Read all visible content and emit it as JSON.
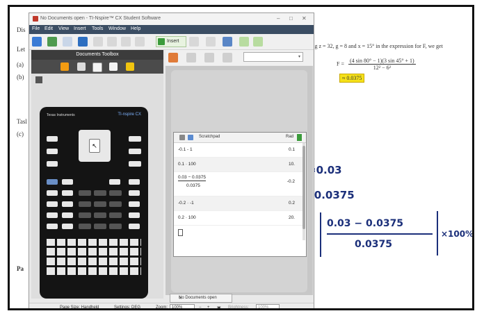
{
  "document": {
    "left_labels": [
      "Dis",
      "Let",
      "(a)",
      "(b)",
      "Tasl",
      "(c)"
    ],
    "body_line": "ting z = 32, g = 8 and x = 15° in the expression for F, we get",
    "formula_lhs": "F =",
    "formula_numerator": "(4 sin 80° − 1)(3 sin 45° + 1)",
    "formula_denominator": "12² − 6²",
    "highlight_value": "≈ 0.0375",
    "highlight_small_1": "P",
    "highlight_small_2": "e",
    "bottom_left_label_1": "Pa",
    "bottom_left_label_2": "P"
  },
  "handwriting": {
    "line1": "≈0.03",
    "line2": "= 0.0375",
    "frac_num": "0.03 − 0.0375",
    "frac_den": "0.0375",
    "frac_prefix": "=",
    "frac_suffix": "×100%."
  },
  "window": {
    "title": "No Documents open - TI-Nspire™ CX Student Software",
    "controls": [
      "–",
      "□",
      "✕"
    ],
    "menu": [
      "File",
      "Edit",
      "View",
      "Insert",
      "Tools",
      "Window",
      "Help"
    ],
    "insert_label": "Insert"
  },
  "toolbox": {
    "title": "Documents Toolbox",
    "calc_brand": "Texas Instruments",
    "calc_model": "TI-nspire CX",
    "calc_center": "↖"
  },
  "scratchpad": {
    "title": "Scratchpad",
    "mode": "Rad",
    "rows": [
      {
        "expr": "-0.1 - 1",
        "value": "0.1"
      },
      {
        "expr": "0.1 · 100",
        "value": "10."
      },
      {
        "expr": "0.03 − 0.0375",
        "den": "0.0375",
        "value": "-0.2"
      },
      {
        "expr": "-0.2 · -1",
        "value": "0.2"
      },
      {
        "expr": "0.2 · 100",
        "value": "20."
      }
    ]
  },
  "doc_tab": {
    "label": "No Documents open",
    "close": "✕"
  },
  "status": {
    "page_size": "Page Size: Handheld",
    "settings": "Settings: DEG",
    "zoom_label": "Zoom:",
    "zoom_value": "100%",
    "brightness_label": "Brightness:",
    "brightness_value": "100%"
  },
  "colors": {
    "highlight": "#f5e11a",
    "ink": "#1b2f7a",
    "menubar": "#3b4d63"
  }
}
